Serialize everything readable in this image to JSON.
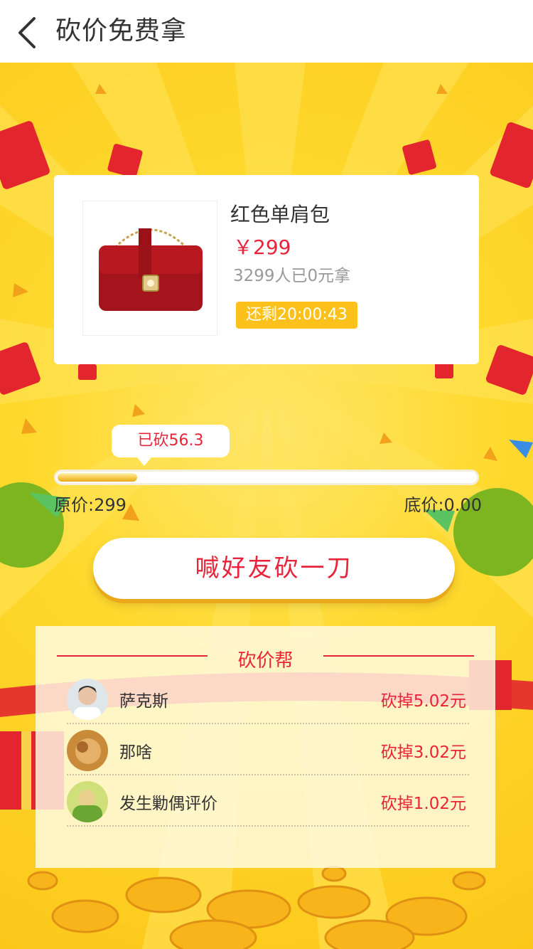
{
  "header": {
    "title": "砍价免费拿"
  },
  "product": {
    "name": "红色单肩包",
    "price": "￥299",
    "sold_text": "3299人已0元拿",
    "countdown": "还剩20:00:43"
  },
  "progress": {
    "bubble_text": "已砍56.3",
    "fraction": 0.19,
    "original_price": "原价:299",
    "floor_price": "底价:0.00"
  },
  "cta": {
    "label": "喊好友砍一刀"
  },
  "helpers": {
    "title": "砍价帮",
    "items": [
      {
        "name": "萨克斯",
        "amount": "砍掉5.02元"
      },
      {
        "name": "那啥",
        "amount": "砍掉3.02元"
      },
      {
        "name": "发生勦偶评价",
        "amount": "砍掉1.02元"
      }
    ]
  },
  "colors": {
    "accent_red": "#e8243a",
    "background_yellow": "#fcd21b",
    "countdown_badge": "#fcc21b"
  }
}
